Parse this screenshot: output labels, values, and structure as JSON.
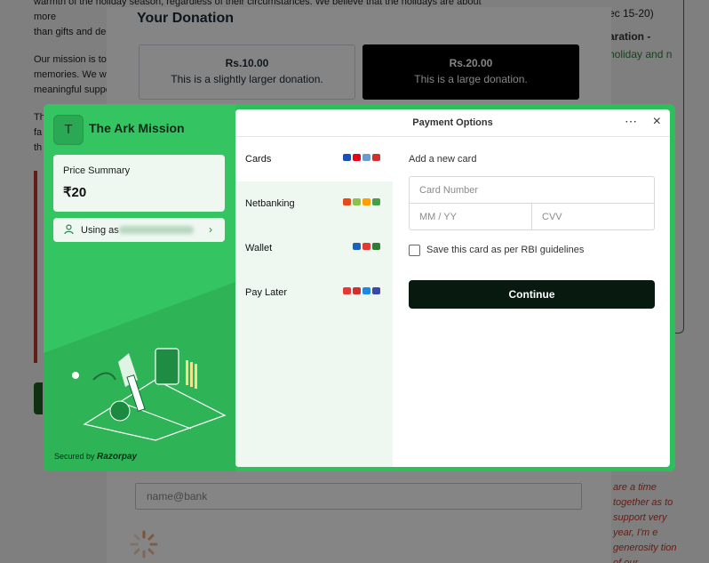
{
  "background_page": {
    "intro_line1": "warmth of the holiday season, regardless of their circumstances. We believe that the holidays are about more",
    "intro_line2": "than gifts and dec",
    "mission_line1": "Our mission is to",
    "mission_line2": "memories. We wo",
    "mission_line3": "meaningful suppo",
    "frag1": "Th",
    "frag2": "fa",
    "frag3": "th",
    "right_date": "ec 15-20)",
    "right_prep": "aration -",
    "right_text": "holiday and n",
    "italic_text": "are a time together as to support very year, I'm e generosity tion of our"
  },
  "donation_modal": {
    "title": "Your Donation",
    "options": [
      {
        "amount": "Rs.10.00",
        "description": "This is a slightly larger donation."
      },
      {
        "amount": "Rs.20.00",
        "description": "This is a large donation."
      }
    ],
    "upi_placeholder": "name@bank"
  },
  "checkout": {
    "merchant_initial": "T",
    "merchant_name": "The Ark Mission",
    "price_summary_label": "Price Summary",
    "price_value": "₹20",
    "using_as_label": "Using as",
    "secured_prefix": "Secured by",
    "secured_brand": "Razorpay",
    "header_title": "Payment Options",
    "more_icon": "⋯",
    "close_icon": "×",
    "methods": [
      {
        "label": "Cards",
        "icon_colors": [
          "#1a4fb6",
          "#eb001b",
          "#6b9bd1",
          "#d32f2f"
        ]
      },
      {
        "label": "Netbanking",
        "icon_colors": [
          "#e64a19",
          "#8bc34a",
          "#ffa000",
          "#43a047"
        ]
      },
      {
        "label": "Wallet",
        "icon_colors": [
          "#1565c0",
          "#e53935",
          "#2e7d32"
        ]
      },
      {
        "label": "Pay Later",
        "icon_colors": [
          "#e53935",
          "#d32f2f",
          "#1e88e5",
          "#3949ab"
        ]
      }
    ],
    "add_card_label": "Add a new card",
    "card_number_placeholder": "Card Number",
    "expiry_placeholder": "MM / YY",
    "cvv_placeholder": "CVV",
    "save_card_label": "Save this card as per RBI guidelines",
    "continue_label": "Continue"
  }
}
